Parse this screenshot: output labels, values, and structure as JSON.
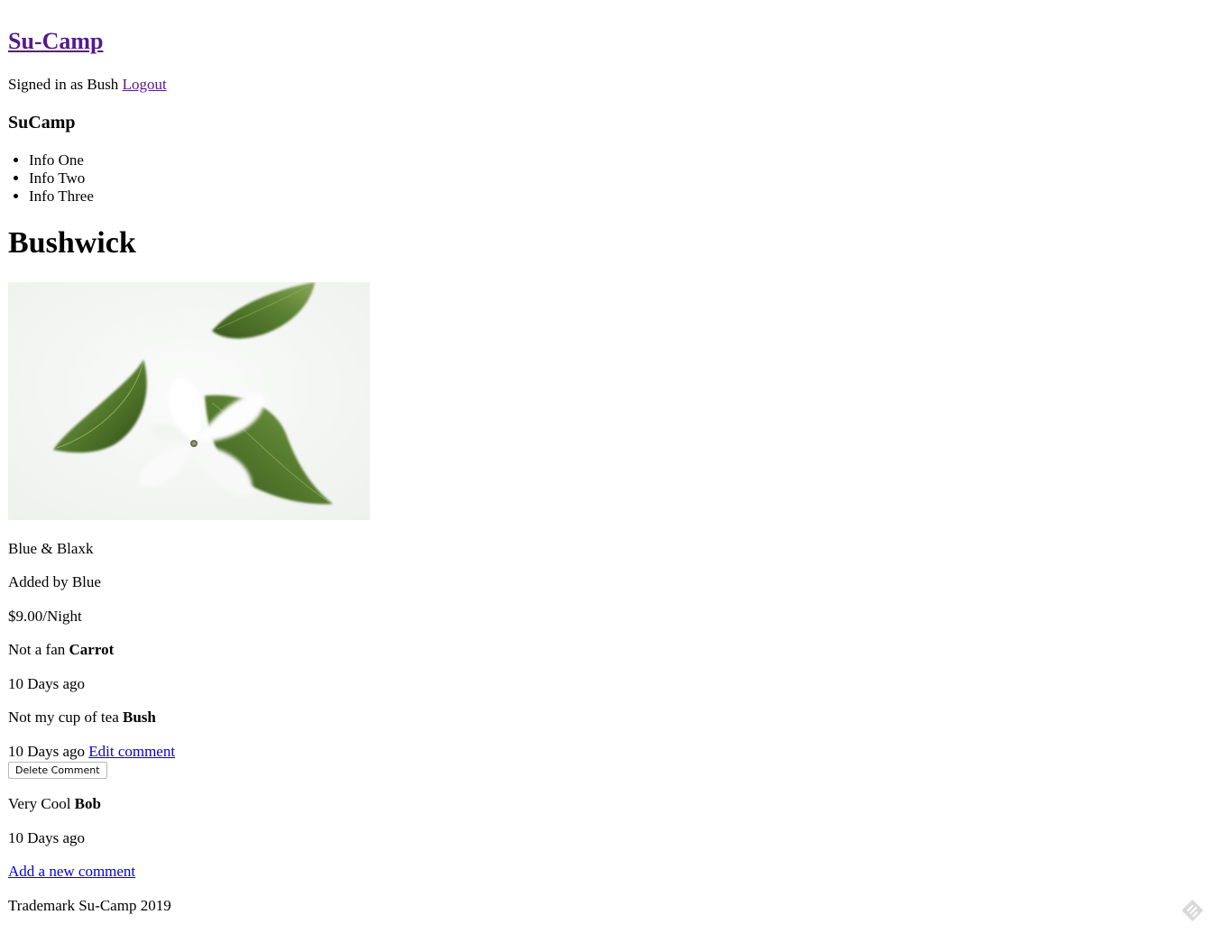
{
  "header": {
    "site_title": "Su-Camp",
    "signed_in_text": "Signed in as Bush",
    "logout_label": "Logout"
  },
  "sidebar": {
    "title": "SuCamp",
    "items": [
      {
        "label": "Info One"
      },
      {
        "label": "Info Two"
      },
      {
        "label": "Info Three"
      }
    ]
  },
  "campground": {
    "name": "Bushwick",
    "description": "Blue & Blaxk",
    "added_by": "Added by Blue",
    "price": "$9.00/Night"
  },
  "comments": [
    {
      "text": "Not a fan",
      "author": "Carrot",
      "time": "10 Days ago"
    },
    {
      "text": "Not my cup of tea",
      "author": "Bush",
      "time": "10 Days ago",
      "edit_label": "Edit comment",
      "delete_label": "Delete Comment"
    },
    {
      "text": "Very Cool",
      "author": "Bob",
      "time": "10 Days ago"
    }
  ],
  "add_comment_label": "Add a new comment",
  "footer": {
    "trademark": "Trademark Su-Camp 2019"
  },
  "icons": {
    "corner": "feedback-icon"
  }
}
